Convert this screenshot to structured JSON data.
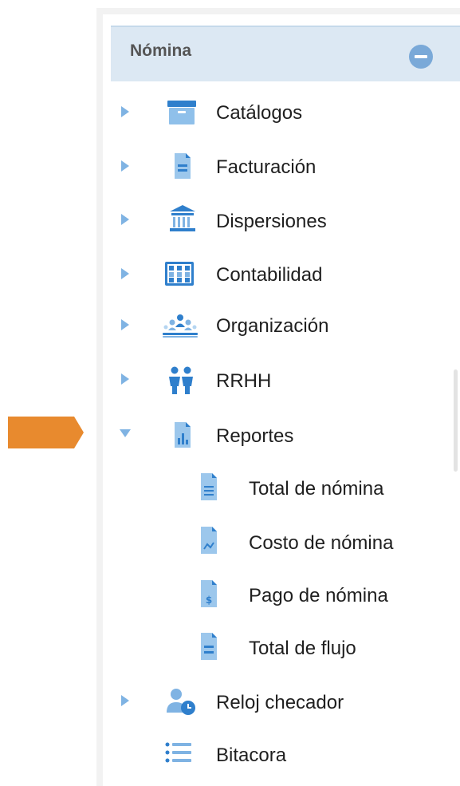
{
  "header": {
    "title": "Nómina"
  },
  "menu": [
    {
      "label": "Catálogos",
      "icon": "archive-box-icon",
      "expanded": false
    },
    {
      "label": "Facturación",
      "icon": "invoice-document-icon",
      "expanded": false
    },
    {
      "label": "Dispersiones",
      "icon": "bank-building-icon",
      "expanded": false
    },
    {
      "label": "Contabilidad",
      "icon": "abacus-calculator-icon",
      "expanded": false
    },
    {
      "label": "Organización",
      "icon": "organization-people-icon",
      "expanded": false
    },
    {
      "label": "RRHH",
      "icon": "people-couple-icon",
      "expanded": false
    },
    {
      "label": "Reportes",
      "icon": "report-chart-document-icon",
      "expanded": true
    }
  ],
  "submenu": [
    {
      "label": "Total de nómina",
      "icon": "document-lines-icon"
    },
    {
      "label": "Costo de nómina",
      "icon": "document-chart-icon"
    },
    {
      "label": "Pago de nómina",
      "icon": "document-dollar-icon"
    },
    {
      "label": "Total de flujo",
      "icon": "document-total-icon"
    }
  ],
  "tail": [
    {
      "label": "Reloj checador",
      "icon": "user-clock-icon",
      "expanded": false
    },
    {
      "label": "Bitacora",
      "icon": "list-bullets-icon"
    }
  ],
  "colors": {
    "accent": "#4a8fd4",
    "arrow": "#7fb3e3",
    "header_bg": "#dce8f3",
    "pointer": "#e88a2e"
  }
}
